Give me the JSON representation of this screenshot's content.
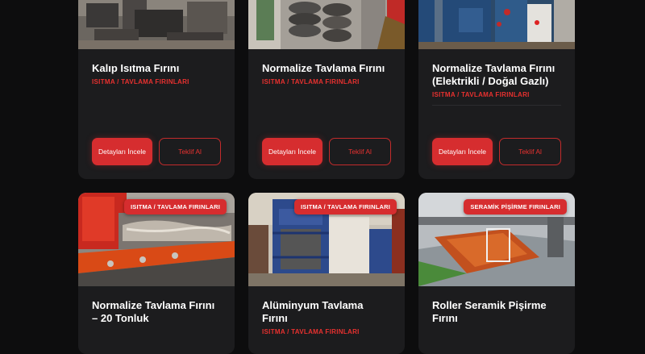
{
  "cards": [
    {
      "title": "Kalıp Isıtma Fırını",
      "category": "ISITMA / TAVLAMA FIRINLARI",
      "btn_details": "Detayları İncele",
      "btn_quote": "Teklif Al"
    },
    {
      "title": "Normalize Tavlama Fırını",
      "category": "ISITMA / TAVLAMA FIRINLARI",
      "btn_details": "Detayları İncele",
      "btn_quote": "Teklif Al"
    },
    {
      "title": "Normalize Tavlama Fırını (Elektrikli / Doğal Gazlı)",
      "category": "ISITMA / TAVLAMA FIRINLARI",
      "btn_details": "Detayları İncele",
      "btn_quote": "Teklif Al"
    },
    {
      "title": "Normalize Tavlama Fırını – 20 Tonluk",
      "badge": "ISITMA / TAVLAMA FIRINLARI"
    },
    {
      "title": "Alüminyum Tavlama Fırını",
      "badge": "ISITMA / TAVLAMA FIRINLARI",
      "category": "ISITMA / TAVLAMA FIRINLARI"
    },
    {
      "title": "Roller Seramik Pişirme Fırını",
      "badge": "SERAMİK PİŞİRME FIRINLARI"
    }
  ]
}
